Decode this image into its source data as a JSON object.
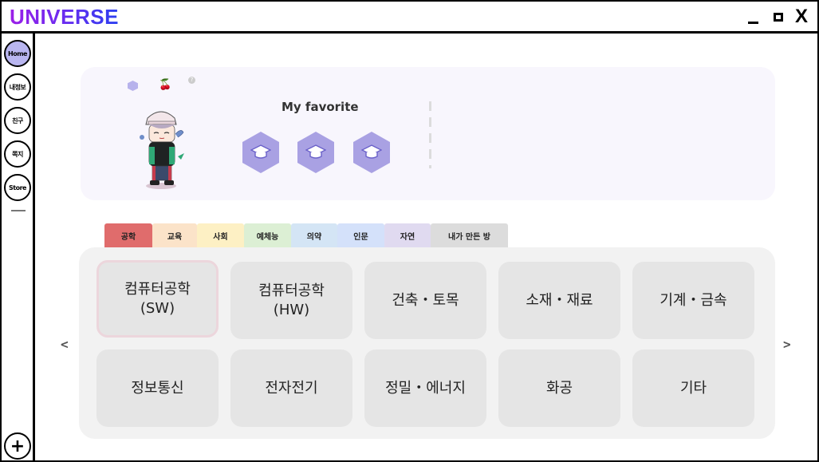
{
  "app": {
    "title": "UNIVERSE"
  },
  "window_controls": {
    "close_label": "X"
  },
  "sidebar": {
    "items": [
      {
        "label": "Home"
      },
      {
        "label": "내정보"
      },
      {
        "label": "친구"
      },
      {
        "label": "쪽지"
      },
      {
        "label": "Store"
      }
    ],
    "add_label": "+"
  },
  "favorites": {
    "title": "My favorite",
    "slots": [
      "graduation-cap-icon",
      "graduation-cap-icon",
      "graduation-cap-icon"
    ],
    "help_label": "?"
  },
  "tabs": [
    {
      "label": "공학",
      "color": "#e06c6c"
    },
    {
      "label": "교육",
      "color": "#fbe3c9"
    },
    {
      "label": "사회",
      "color": "#fdf0c4"
    },
    {
      "label": "예체능",
      "color": "#dcefd4"
    },
    {
      "label": "의약",
      "color": "#d4e5f5"
    },
    {
      "label": "인문",
      "color": "#d4e1fa"
    },
    {
      "label": "자연",
      "color": "#e0daf0"
    },
    {
      "label": "내가 만든 방",
      "color": "#dcdcdc"
    }
  ],
  "categories": [
    {
      "label": "컴퓨터공학\n(SW)"
    },
    {
      "label": "컴퓨터공학\n(HW)"
    },
    {
      "label": "건축・토목"
    },
    {
      "label": "소재・재료"
    },
    {
      "label": "기계・금속"
    },
    {
      "label": "정보통신"
    },
    {
      "label": "전자전기"
    },
    {
      "label": "정밀・에너지"
    },
    {
      "label": "화공"
    },
    {
      "label": "기타"
    }
  ],
  "nav": {
    "prev": "<",
    "next": ">"
  }
}
